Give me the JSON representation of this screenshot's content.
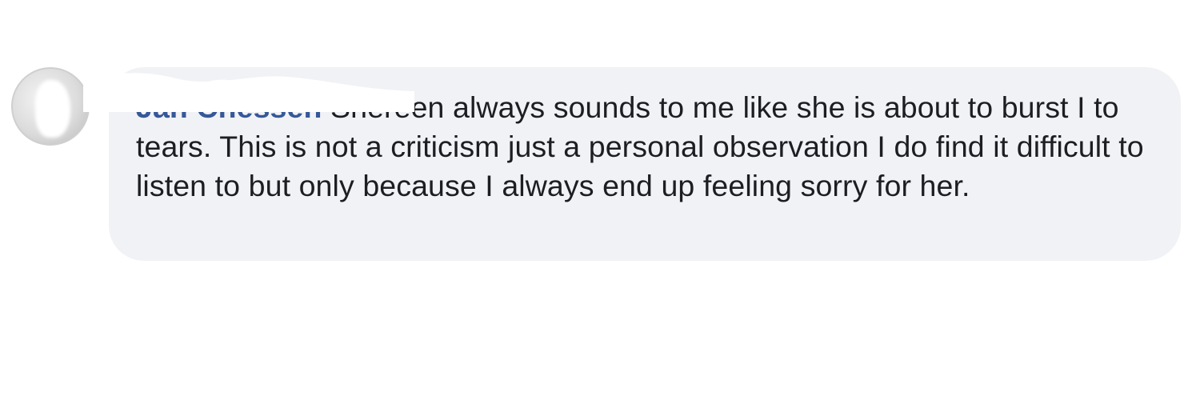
{
  "comment": {
    "author_name": "Jan Chessen",
    "text": "Shereen always sounds to me like she is about to burst I to tears. This is not a criticism just a personal observation I do find it difficult to listen to but only because I always end up feeling sorry for her."
  },
  "colors": {
    "bubble_background": "#f1f2f5",
    "author_link": "#365899",
    "text": "#1c1e21"
  },
  "icons": {
    "avatar": "profile-photo-redacted"
  }
}
